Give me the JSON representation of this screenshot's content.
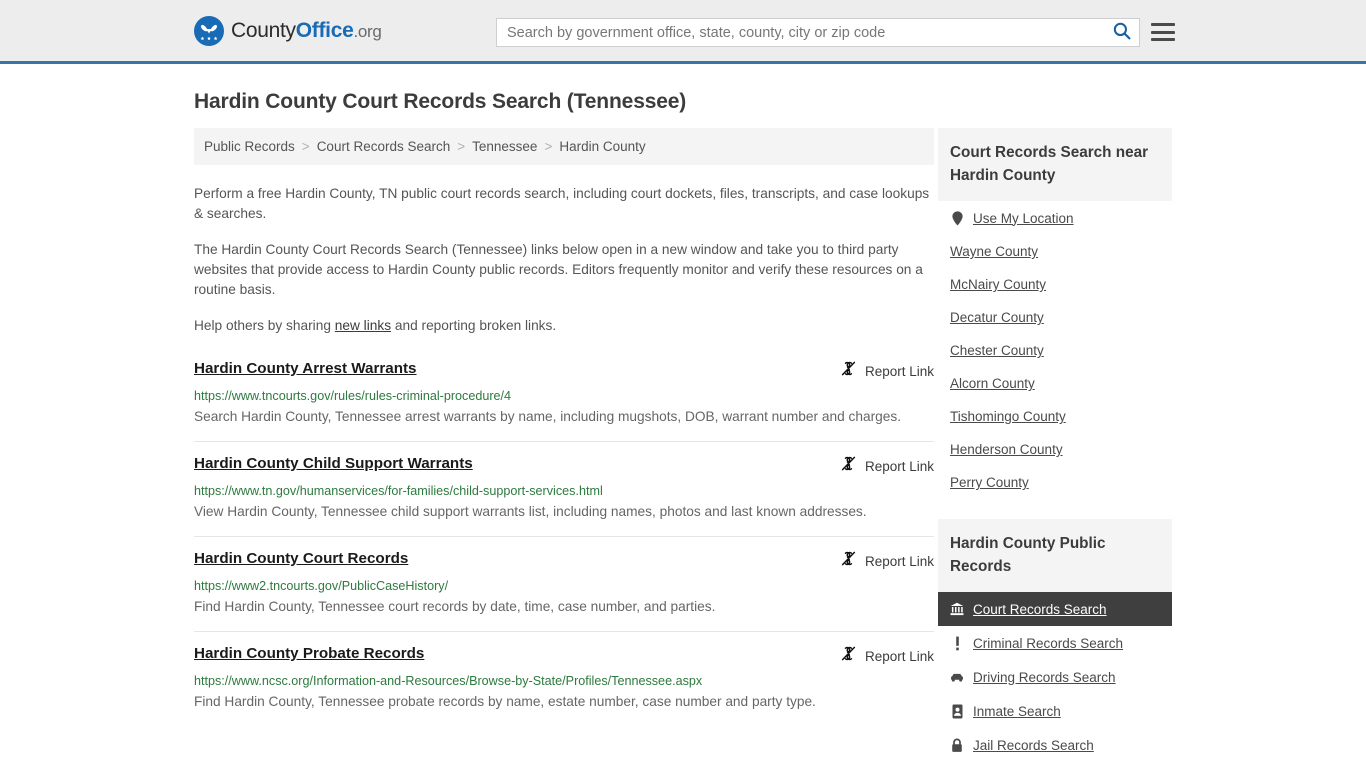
{
  "header": {
    "logo": {
      "part1": "County",
      "part2": "Office",
      "part3": ".org",
      "icon": "eagle-seal-icon"
    },
    "search": {
      "placeholder": "Search by government office, state, county, city or zip code",
      "value": "",
      "icon": "search-icon"
    },
    "menu_icon": "hamburger-menu-icon",
    "accent_color": "#3a75a8",
    "background_color": "#ededed"
  },
  "page_title": "Hardin County Court Records Search (Tennessee)",
  "breadcrumb": {
    "items": [
      {
        "label": "Public Records"
      },
      {
        "label": "Court Records Search"
      },
      {
        "label": "Tennessee"
      },
      {
        "label": "Hardin County"
      }
    ],
    "separator": ">"
  },
  "intro": {
    "p1": "Perform a free Hardin County, TN public court records search, including court dockets, files, transcripts, and case lookups & searches.",
    "p2": "The Hardin County Court Records Search (Tennessee) links below open in a new window and take you to third party websites that provide access to Hardin County public records. Editors frequently monitor and verify these resources on a routine basis.",
    "p3_before": "Help others by sharing ",
    "p3_link": "new links",
    "p3_after": " and reporting broken links."
  },
  "report_link_label": "Report Link",
  "report_link_icon": "broken-link-icon",
  "results": [
    {
      "title": "Hardin County Arrest Warrants",
      "url": "https://www.tncourts.gov/rules/rules-criminal-procedure/4",
      "description": "Search Hardin County, Tennessee arrest warrants by name, including mugshots, DOB, warrant number and charges."
    },
    {
      "title": "Hardin County Child Support Warrants",
      "url": "https://www.tn.gov/humanservices/for-families/child-support-services.html",
      "description": "View Hardin County, Tennessee child support warrants list, including names, photos and last known addresses."
    },
    {
      "title": "Hardin County Court Records",
      "url": "https://www2.tncourts.gov/PublicCaseHistory/",
      "description": "Find Hardin County, Tennessee court records by date, time, case number, and parties."
    },
    {
      "title": "Hardin County Probate Records",
      "url": "https://www.ncsc.org/Information-and-Resources/Browse-by-State/Profiles/Tennessee.aspx",
      "description": "Find Hardin County, Tennessee probate records by name, estate number, case number and party type."
    }
  ],
  "sidebar": {
    "nearby": {
      "heading": "Court Records Search near Hardin County",
      "items": [
        {
          "label": "Use My Location",
          "icon": "map-pin-icon"
        },
        {
          "label": "Wayne County",
          "icon": ""
        },
        {
          "label": "McNairy County",
          "icon": ""
        },
        {
          "label": "Decatur County",
          "icon": ""
        },
        {
          "label": "Chester County",
          "icon": ""
        },
        {
          "label": "Alcorn County",
          "icon": ""
        },
        {
          "label": "Tishomingo County",
          "icon": ""
        },
        {
          "label": "Henderson County",
          "icon": ""
        },
        {
          "label": "Perry County",
          "icon": ""
        }
      ]
    },
    "public_records": {
      "heading": "Hardin County Public Records",
      "active_color": "#3f3f3f",
      "items": [
        {
          "label": "Court Records Search",
          "icon": "courthouse-icon",
          "active": true
        },
        {
          "label": "Criminal Records Search",
          "icon": "exclamation-icon",
          "active": false
        },
        {
          "label": "Driving Records Search",
          "icon": "car-icon",
          "active": false
        },
        {
          "label": "Inmate Search",
          "icon": "id-card-icon",
          "active": false
        },
        {
          "label": "Jail Records Search",
          "icon": "lock-icon",
          "active": false
        }
      ]
    }
  }
}
